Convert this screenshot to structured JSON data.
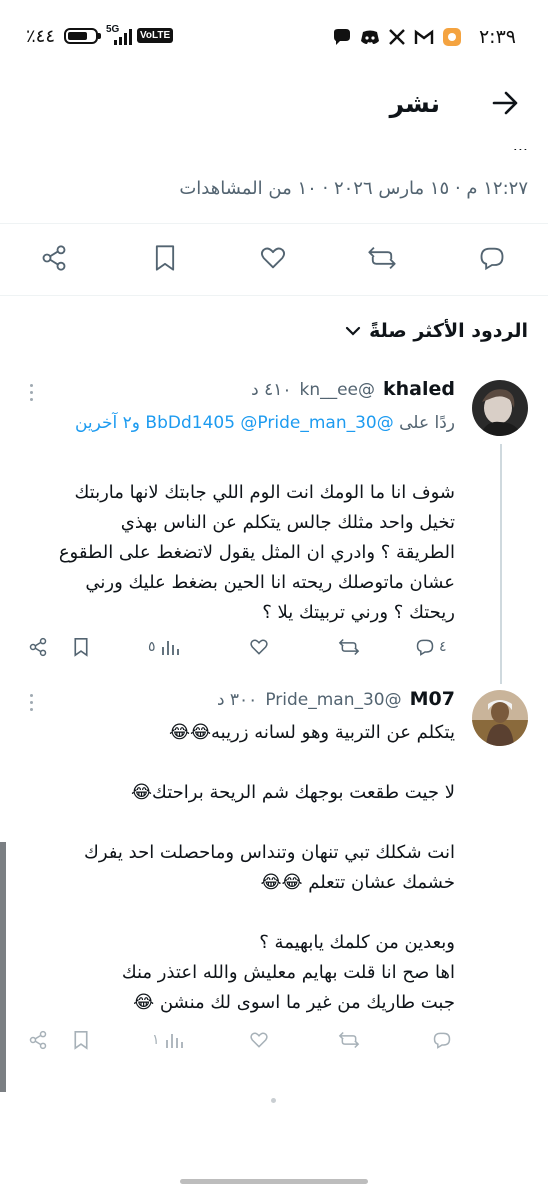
{
  "status_bar": {
    "time": "٢:٣٩",
    "battery": "٪٤٤",
    "network": "5G",
    "volte": "VoLTE"
  },
  "header": {
    "title": "نشر",
    "back_icon": "arrow-right-icon"
  },
  "tweet": {
    "cut_text": "...",
    "meta": "١٢:٢٧ م · ١٥ مارس ٢٠٢٦ · ١٠ من المشاهدات"
  },
  "actions": {
    "icons": [
      "reply-icon",
      "retweet-icon",
      "like-icon",
      "bookmark-icon",
      "share-icon"
    ]
  },
  "sort": {
    "label": "الردود الأكثر صلةً"
  },
  "replies": [
    {
      "name": "khaled",
      "handle": "@kn__ee",
      "time": "٤١٠ د",
      "reply_prefix": "ردًا على",
      "mentions": "@BbDd1405 @Pride_man_30",
      "reply_suffix": "و٢ آخرين",
      "body": "شوف انا ما الومك انت الوم اللي جابتك لانها ماربتك\nتخيل واحد مثلك جالس يتكلم عن الناس بهذي\nالطريقة ؟ وادري ان المثل يقول لاتضغط على الطقوع\nعشان ماتوصلك ريحته انا الحين بضغط عليك ورني\nريحتك ؟ ورني تربيتك يلا ؟",
      "reply_count": "٤",
      "retweet_count": "",
      "views": "٥"
    },
    {
      "name": "M07",
      "handle": "@Pride_man_30",
      "time": "٣٠٠ د",
      "body": "يتكلم عن التربية وهو لسانه زريبه😂😂\n\nلا جيت طقعت بوجهك شم الريحة براحتك😂\n\nانت شكلك تبي تنهان وتنداس وماحصلت احد يفرك\nخشمك عشان تتعلم 😂😂\n\nوبعدين من كلمك يابهيمة ؟\nاها صح انا قلت بهايم معليش والله اعتذر منك\nجبت طاريك من غير ما اسوى لك منشن 😂",
      "views": "١"
    }
  ]
}
